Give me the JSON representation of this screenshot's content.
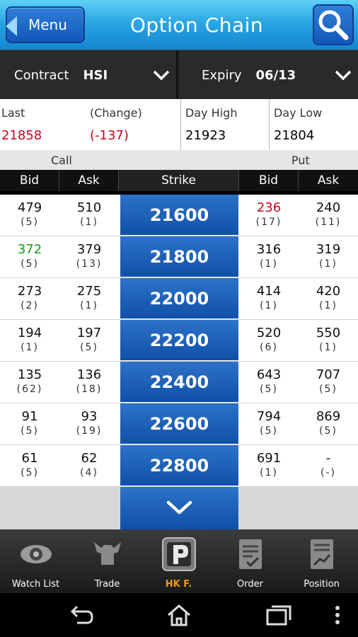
{
  "header": {
    "menu_label": "Menu",
    "title": "Option Chain",
    "search_icon": "search-icon"
  },
  "selector": {
    "contract_label": "Contract",
    "contract_value": "HSI",
    "expiry_label": "Expiry",
    "expiry_value": "06/13"
  },
  "stats": {
    "last_label": "Last",
    "last_value": "21858",
    "change_label": "(Change)",
    "change_value": "(-137)",
    "day_high_label": "Day High",
    "day_high_value": "21923",
    "day_low_label": "Day Low",
    "day_low_value": "21804"
  },
  "sections": {
    "call": "Call",
    "put": "Put"
  },
  "columns": {
    "bid": "Bid",
    "ask": "Ask",
    "strike": "Strike",
    "put_bid": "Bid",
    "put_ask": "Ask"
  },
  "rows": [
    {
      "call_bid": "479",
      "call_bid_qty": "(5)",
      "call_ask": "510",
      "call_ask_qty": "(1)",
      "strike": "21600",
      "put_bid": "236",
      "put_bid_qty": "(17)",
      "put_ask": "240",
      "put_ask_qty": "(11)"
    },
    {
      "call_bid": "372",
      "call_bid_qty": "(5)",
      "call_ask": "379",
      "call_ask_qty": "(13)",
      "strike": "21800",
      "put_bid": "316",
      "put_bid_qty": "(1)",
      "put_ask": "319",
      "put_ask_qty": "(1)"
    },
    {
      "call_bid": "273",
      "call_bid_qty": "(2)",
      "call_ask": "275",
      "call_ask_qty": "(1)",
      "strike": "22000",
      "put_bid": "414",
      "put_bid_qty": "(1)",
      "put_ask": "420",
      "put_ask_qty": "(1)"
    },
    {
      "call_bid": "194",
      "call_bid_qty": "(1)",
      "call_ask": "197",
      "call_ask_qty": "(5)",
      "strike": "22200",
      "put_bid": "520",
      "put_bid_qty": "(6)",
      "put_ask": "550",
      "put_ask_qty": "(1)"
    },
    {
      "call_bid": "135",
      "call_bid_qty": "(62)",
      "call_ask": "136",
      "call_ask_qty": "(18)",
      "strike": "22400",
      "put_bid": "643",
      "put_bid_qty": "(5)",
      "put_ask": "707",
      "put_ask_qty": "(5)"
    },
    {
      "call_bid": "91",
      "call_bid_qty": "(5)",
      "call_ask": "93",
      "call_ask_qty": "(19)",
      "strike": "22600",
      "put_bid": "794",
      "put_bid_qty": "(5)",
      "put_ask": "869",
      "put_ask_qty": "(5)"
    },
    {
      "call_bid": "61",
      "call_bid_qty": "(5)",
      "call_ask": "62",
      "call_ask_qty": "(4)",
      "strike": "22800",
      "put_bid": "691",
      "put_bid_qty": "(1)",
      "put_ask": "-",
      "put_ask_qty": "(-)"
    }
  ],
  "colors": {
    "up": "#1a9a1a",
    "down": "#d0021b",
    "strike_bg": "#1a5fb8",
    "nav_active": "#f29a1d"
  },
  "bottom_nav": [
    {
      "label": "Watch List",
      "icon": "eye-icon"
    },
    {
      "label": "Trade",
      "icon": "bull-icon"
    },
    {
      "label": "HK F.",
      "icon": "p-logo-icon",
      "active": true
    },
    {
      "label": "Order",
      "icon": "order-form-icon"
    },
    {
      "label": "Position",
      "icon": "position-chart-icon"
    }
  ],
  "system_bar": {
    "back": "back-icon",
    "home": "home-icon",
    "recents": "recents-icon",
    "more": "overflow-icon"
  }
}
